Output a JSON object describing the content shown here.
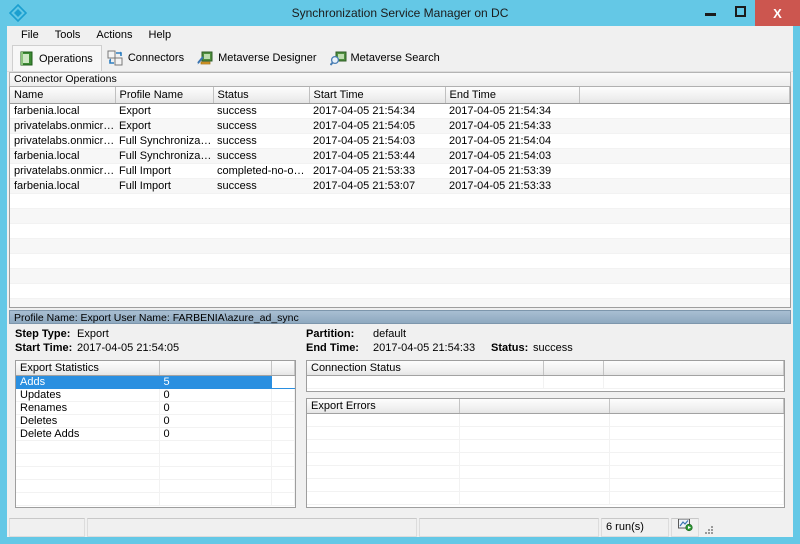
{
  "window": {
    "title": "Synchronization Service Manager on DC",
    "icon": "sync-diamond-icon",
    "accent_color": "#64c8e6",
    "close_color": "#cc564f",
    "controls": {
      "minimize": "minimize-icon",
      "maximize": "maximize-icon",
      "close": "X"
    }
  },
  "menubar": {
    "items": [
      {
        "label": "File"
      },
      {
        "label": "Tools"
      },
      {
        "label": "Actions"
      },
      {
        "label": "Help"
      }
    ]
  },
  "toolbar": {
    "buttons": [
      {
        "label": "Operations",
        "icon": "green-book-icon",
        "active": true
      },
      {
        "label": "Connectors",
        "icon": "connectors-icon",
        "active": false
      },
      {
        "label": "Metaverse Designer",
        "icon": "metaverse-designer-icon",
        "active": false
      },
      {
        "label": "Metaverse Search",
        "icon": "metaverse-search-icon",
        "active": false
      }
    ]
  },
  "operations": {
    "group_title": "Connector Operations",
    "columns": [
      "Name",
      "Profile Name",
      "Status",
      "Start Time",
      "End Time",
      ""
    ],
    "rows": [
      {
        "name": "farbenia.local",
        "profile_name": "Export",
        "status": "success",
        "start_time": "2017-04-05 21:54:34",
        "end_time": "2017-04-05 21:54:34",
        "extra": ""
      },
      {
        "name": "privatelabs.onmicrosof...",
        "profile_name": "Export",
        "status": "success",
        "start_time": "2017-04-05 21:54:05",
        "end_time": "2017-04-05 21:54:33",
        "extra": ""
      },
      {
        "name": "privatelabs.onmicrosof...",
        "profile_name": "Full Synchronization",
        "status": "success",
        "start_time": "2017-04-05 21:54:03",
        "end_time": "2017-04-05 21:54:04",
        "extra": ""
      },
      {
        "name": "farbenia.local",
        "profile_name": "Full Synchronization",
        "status": "success",
        "start_time": "2017-04-05 21:53:44",
        "end_time": "2017-04-05 21:54:03",
        "extra": ""
      },
      {
        "name": "privatelabs.onmicrosof...",
        "profile_name": "Full Import",
        "status": "completed-no-objects",
        "start_time": "2017-04-05 21:53:33",
        "end_time": "2017-04-05 21:53:39",
        "extra": ""
      },
      {
        "name": "farbenia.local",
        "profile_name": "Full Import",
        "status": "success",
        "start_time": "2017-04-05 21:53:07",
        "end_time": "2017-04-05 21:53:33",
        "extra": ""
      }
    ]
  },
  "detail": {
    "profile_bar": "Profile Name: Export  User Name: FARBENIA\\azure_ad_sync",
    "fields": {
      "step_type_label": "Step Type:",
      "step_type_value": "Export",
      "start_time_label": "Start Time:",
      "start_time_value": "2017-04-05 21:54:05",
      "partition_label": "Partition:",
      "partition_value": "default",
      "end_time_label": "End Time:",
      "end_time_value": "2017-04-05 21:54:33",
      "status_label": "Status:",
      "status_value": "success"
    },
    "export_statistics": {
      "header": "Export Statistics",
      "rows": [
        {
          "label": "Adds",
          "value": "5",
          "selected": true
        },
        {
          "label": "Updates",
          "value": "0",
          "selected": false
        },
        {
          "label": "Renames",
          "value": "0",
          "selected": false
        },
        {
          "label": "Deletes",
          "value": "0",
          "selected": false
        },
        {
          "label": "Delete Adds",
          "value": "0",
          "selected": false
        }
      ]
    },
    "connection_status": {
      "header": "Connection Status",
      "rows": []
    },
    "export_errors": {
      "header": "Export Errors",
      "rows": []
    }
  },
  "statusbar": {
    "panel1": "",
    "panel2": "",
    "panel3": "",
    "run_count": "6 run(s)",
    "icon": "running-operation-icon"
  }
}
